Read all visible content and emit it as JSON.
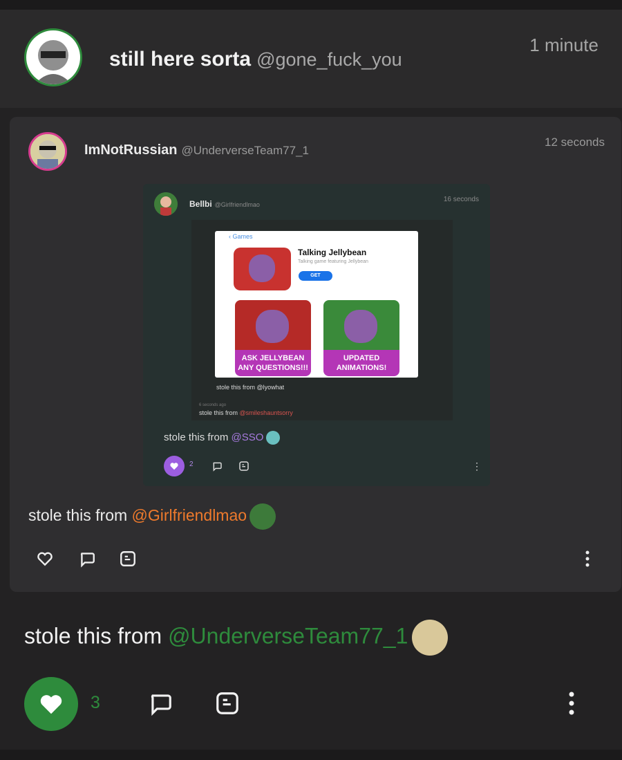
{
  "post": {
    "author_name": "still here sorta",
    "author_handle": "@gone_fuck_you",
    "time": "1 minute",
    "caption_prefix": "stole this from",
    "caption_mention": "@UnderverseTeam77_1",
    "like_count": "3",
    "liked": true,
    "accent_color": "#2e8b3c"
  },
  "quoted": {
    "author_name": "ImNotRussian",
    "author_handle": "@UnderverseTeam77_1",
    "time": "12 seconds",
    "caption_prefix": "stole this from",
    "caption_mention": "@Girlfriendlmao",
    "mention_color": "#ee7a2c"
  },
  "nested": {
    "author_name": "Bellbi",
    "author_handle": "@Girlfriendlmao",
    "time": "16 seconds",
    "screenshot": {
      "back_label": "Games",
      "app_title": "Talking Jellybean",
      "app_subtitle": "Talking game featuring Jellybean",
      "get_label": "GET",
      "tile1_label": "ASK JELLYBEAN ANY QUESTIONS!!!",
      "tile2_label": "UPDATED ANIMATIONS!"
    },
    "inner_caption": "stole this from @lyowhat",
    "tiny_time": "6 seconds ago",
    "inner_caption2_prefix": "stole this from",
    "inner_caption2_mention": "@smileshauntsorry",
    "caption_prefix": "stole this from",
    "caption_mention": "@SSO",
    "like_count": "2"
  },
  "icons": [
    "heart-icon",
    "comment-icon",
    "quote-icon",
    "more-icon"
  ]
}
